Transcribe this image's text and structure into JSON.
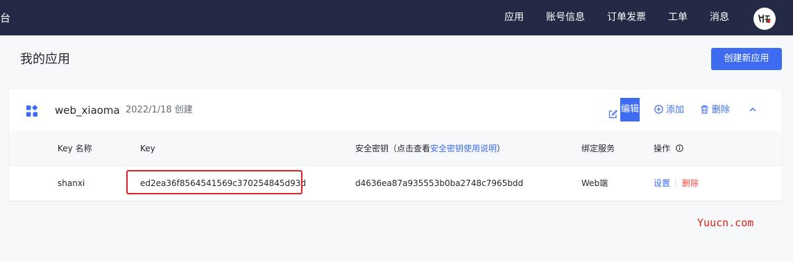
{
  "topbar": {
    "brand": "台",
    "nav": [
      {
        "label": "应用"
      },
      {
        "label": "账号信息"
      },
      {
        "label": "订单发票"
      },
      {
        "label": "工单"
      },
      {
        "label": "消息"
      }
    ]
  },
  "page": {
    "title": "我的应用",
    "create_button": "创建新应用"
  },
  "app": {
    "name": "web_xiaoma",
    "created": "2022/1/18 创建",
    "actions": {
      "edit": "编辑",
      "add": "添加",
      "delete": "删除"
    }
  },
  "table": {
    "headers": {
      "name": "Key 名称",
      "key": "Key",
      "secret_prefix": "安全密钥（点击查看",
      "secret_link": "安全密钥使用说明",
      "secret_suffix": "）",
      "service": "绑定服务",
      "ops": "操作"
    },
    "rows": [
      {
        "name": "shanxi",
        "key": "ed2ea36f8564541569c370254845d93d",
        "secret": "d4636ea87a935553b0ba2748c7965bdd",
        "service": "Web端",
        "settings": "设置",
        "delete": "删除"
      }
    ]
  },
  "watermark": "Yuucn.com",
  "colors": {
    "topbar_bg": "#242a45",
    "primary": "#3d6cf0",
    "danger": "#f5474a",
    "highlight_box": "#e02020",
    "watermark": "#e0201b"
  }
}
